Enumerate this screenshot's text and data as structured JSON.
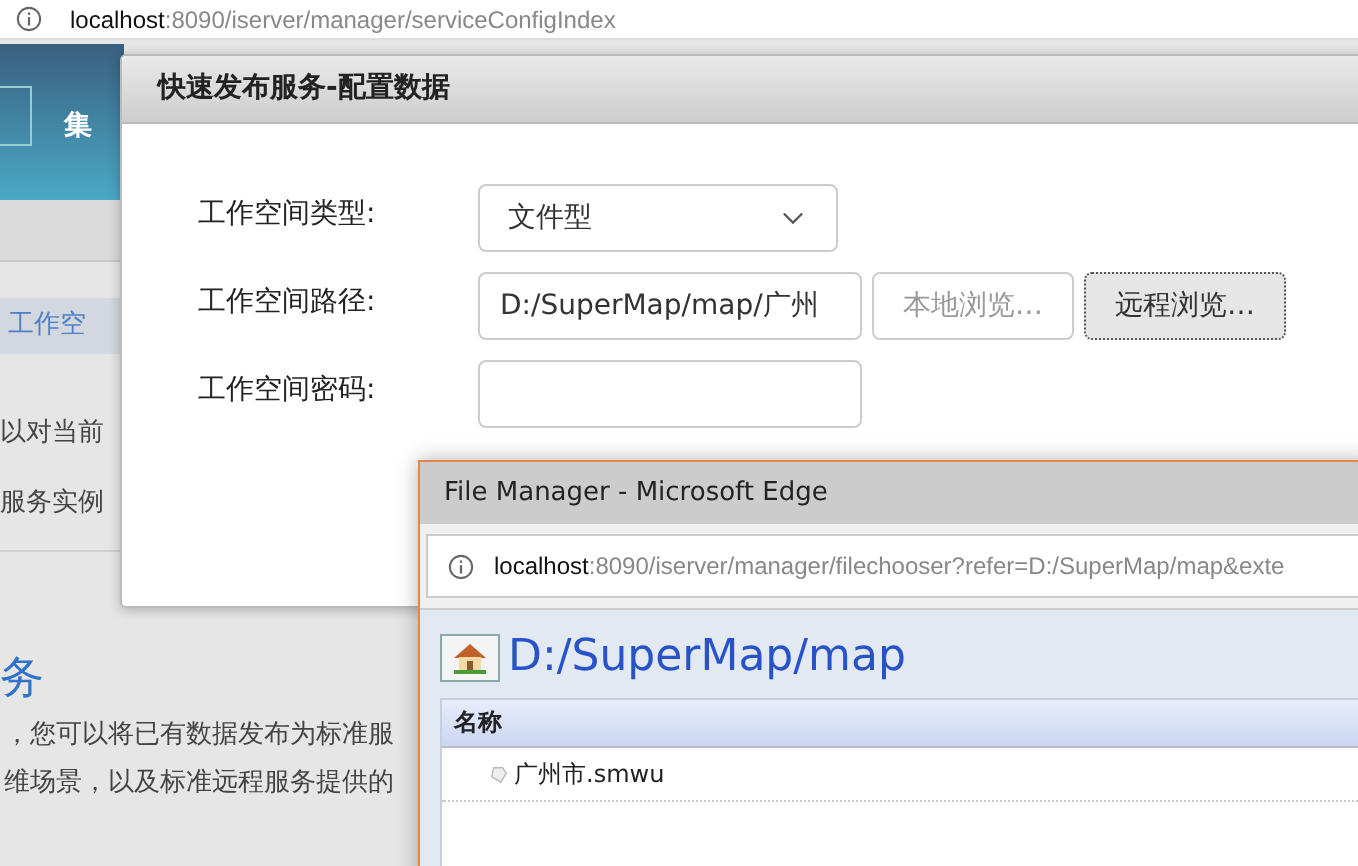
{
  "browser": {
    "address_host": "localhost",
    "address_path": ":8090/iserver/manager/serviceConfigIndex"
  },
  "page": {
    "header_title": "集",
    "sidebar_items": [
      {
        "label": "工作空",
        "selected": true
      }
    ],
    "text_lines": [
      "以对当前",
      "服务实例"
    ],
    "section_heading": "务",
    "paragraph_lines": [
      "，您可以将已有数据发布为标准服",
      "维场景，以及标准远程服务提供的"
    ]
  },
  "dialog": {
    "title": "快速发布服务-配置数据",
    "fields": [
      {
        "kind": "select",
        "label": "工作空间类型:",
        "value": "文件型"
      },
      {
        "kind": "path",
        "label": "工作空间路径:",
        "value": "D:/SuperMap/map/广州",
        "buttons": [
          {
            "label": "本地浏览…",
            "disabled": true,
            "focused": false
          },
          {
            "label": "远程浏览…",
            "disabled": false,
            "focused": true
          }
        ]
      },
      {
        "kind": "password",
        "label": "工作空间密码:"
      }
    ]
  },
  "popup": {
    "title": "File Manager - Microsoft Edge",
    "address_host": "localhost",
    "address_path": ":8090/iserver/manager/filechooser?refer=D:/SuperMap/map&exte",
    "current_path": "D:/SuperMap/map",
    "columns": [
      "名称"
    ],
    "files": [
      {
        "name": "广州市.smwu"
      }
    ]
  }
}
